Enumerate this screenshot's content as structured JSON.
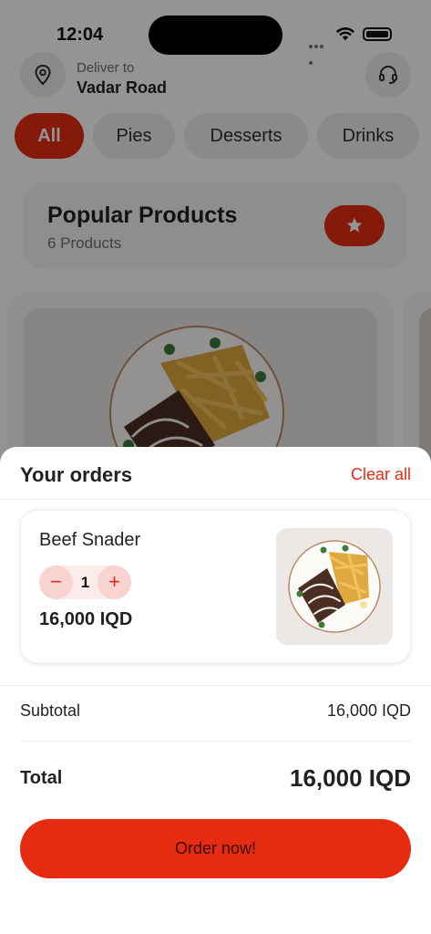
{
  "status_bar": {
    "time": "12:04"
  },
  "header": {
    "deliver_label": "Deliver to",
    "address": "Vadar Road",
    "location_icon": "map-pin-icon",
    "support_icon": "headset-icon"
  },
  "categories": [
    "All",
    "Pies",
    "Desserts",
    "Drinks"
  ],
  "selected_category": "All",
  "popular": {
    "title": "Popular Products",
    "count": "6 Products",
    "icon": "star-icon"
  },
  "orders_sheet": {
    "title": "Your orders",
    "clear_label": "Clear all",
    "items": [
      {
        "name": "Beef Snader",
        "quantity": "1",
        "price": "16,000 IQD",
        "minus": "−",
        "plus": "+"
      }
    ],
    "subtotal_label": "Subtotal",
    "subtotal_value": "16,000 IQD",
    "total_label": "Total",
    "total_value": "16,000 IQD",
    "order_button": "Order now!"
  },
  "colors": {
    "accent": "#e52b12",
    "accent_soft": "#fbeceb",
    "text": "#1f2225",
    "muted": "#6b6f73"
  }
}
